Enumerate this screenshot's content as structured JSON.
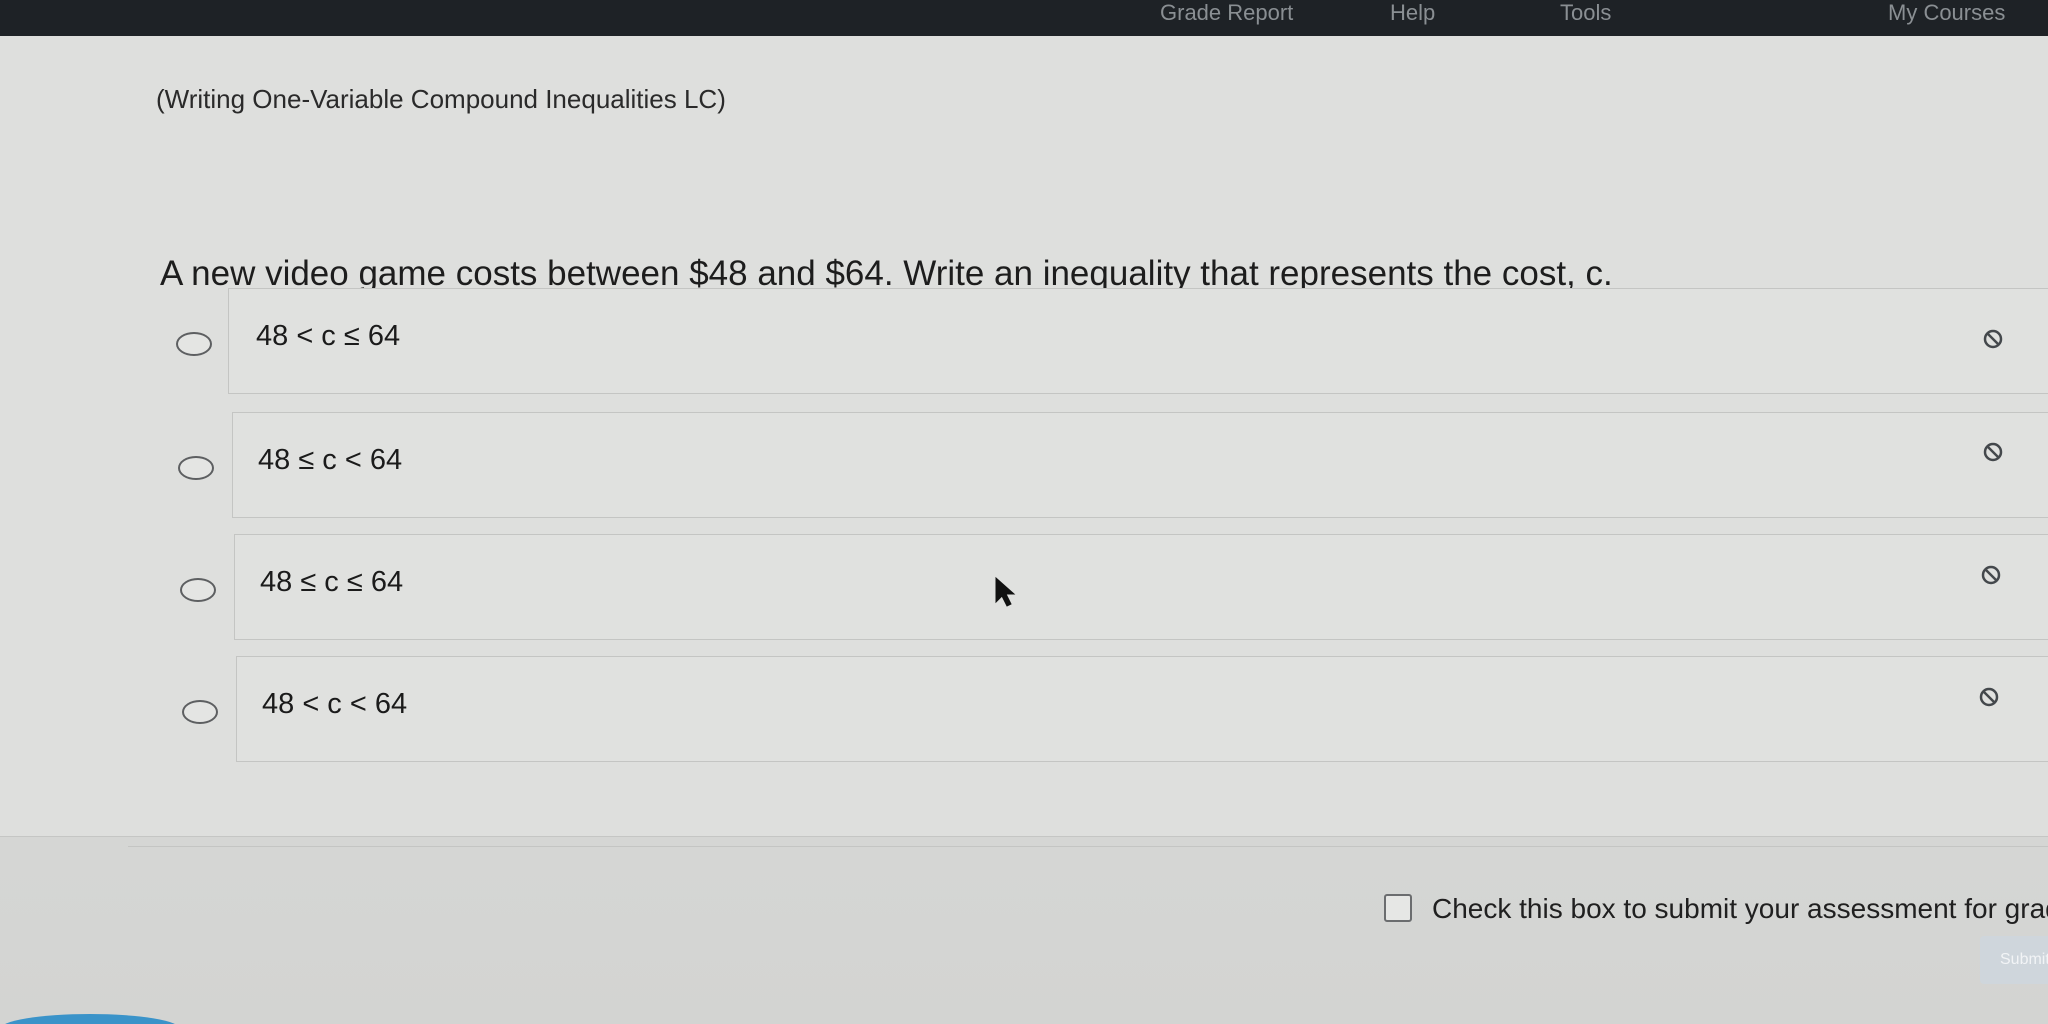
{
  "topbar": {
    "items": [
      "Grade Report",
      "Help",
      "Tools",
      "My Courses"
    ]
  },
  "assessment": {
    "title": "(Writing One-Variable Compound Inequalities LC)",
    "question": "A new video game costs between $48 and $64. Write an inequality that represents the cost, c.",
    "choices": [
      {
        "label": "48 < c ≤ 64"
      },
      {
        "label": "48 ≤ c < 64"
      },
      {
        "label": "48 ≤ c ≤ 64"
      },
      {
        "label": "48 < c < 64"
      }
    ],
    "submit_checkbox_label": "Check this box to submit your assessment for gradin",
    "submit_button_label": "Submit"
  },
  "icons": {
    "radio": "radio-button-icon",
    "eliminate": "eliminate-choice-icon",
    "checkbox": "checkbox-icon",
    "cursor": "mouse-pointer-icon"
  },
  "colors": {
    "background": "#dcdddb",
    "topbar": "#1e2226",
    "text": "#1d1d1d",
    "border": "#c4c5c3",
    "accent": "#3a93c9"
  }
}
